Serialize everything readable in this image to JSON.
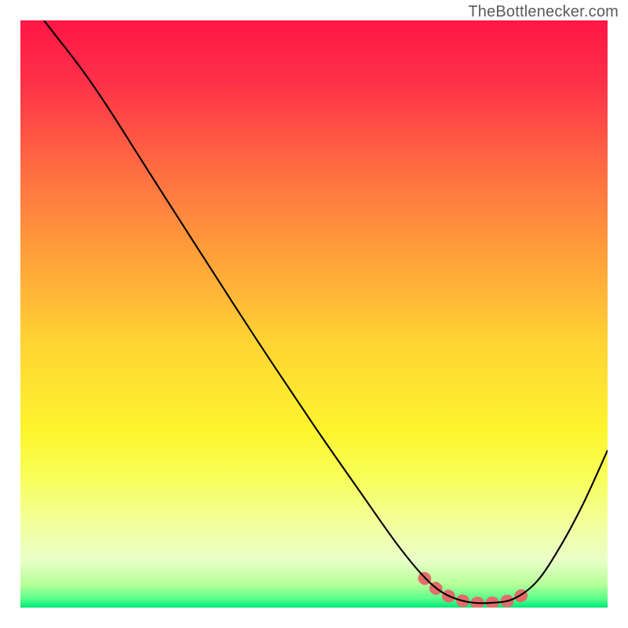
{
  "watermark": "TheBottlenecker.com",
  "chart_data": {
    "type": "line",
    "title": "",
    "xlabel": "",
    "ylabel": "",
    "xlim": [
      0,
      1
    ],
    "ylim": [
      0,
      1
    ],
    "gradient_stops": [
      {
        "offset": 0.0,
        "color": "#ff1744"
      },
      {
        "offset": 0.1,
        "color": "#ff2f49"
      },
      {
        "offset": 0.25,
        "color": "#ff6b42"
      },
      {
        "offset": 0.4,
        "color": "#ffa03a"
      },
      {
        "offset": 0.55,
        "color": "#ffd433"
      },
      {
        "offset": 0.7,
        "color": "#fdf52e"
      },
      {
        "offset": 0.78,
        "color": "#f8ff5a"
      },
      {
        "offset": 0.86,
        "color": "#f2ffa0"
      },
      {
        "offset": 0.92,
        "color": "#e8ffc8"
      },
      {
        "offset": 0.96,
        "color": "#b8ff9a"
      },
      {
        "offset": 0.985,
        "color": "#5aff8a"
      },
      {
        "offset": 1.0,
        "color": "#00e878"
      }
    ],
    "series": [
      {
        "name": "curve",
        "color": "#000000",
        "width": 2.1,
        "points": [
          {
            "x": 0.04,
            "y": 1.0
          },
          {
            "x": 0.065,
            "y": 0.968
          },
          {
            "x": 0.09,
            "y": 0.936
          },
          {
            "x": 0.12,
            "y": 0.895
          },
          {
            "x": 0.16,
            "y": 0.835
          },
          {
            "x": 0.22,
            "y": 0.74
          },
          {
            "x": 0.3,
            "y": 0.615
          },
          {
            "x": 0.4,
            "y": 0.46
          },
          {
            "x": 0.5,
            "y": 0.31
          },
          {
            "x": 0.58,
            "y": 0.195
          },
          {
            "x": 0.64,
            "y": 0.11
          },
          {
            "x": 0.685,
            "y": 0.055
          },
          {
            "x": 0.72,
            "y": 0.025
          },
          {
            "x": 0.76,
            "y": 0.01
          },
          {
            "x": 0.8,
            "y": 0.008
          },
          {
            "x": 0.84,
            "y": 0.015
          },
          {
            "x": 0.88,
            "y": 0.045
          },
          {
            "x": 0.92,
            "y": 0.105
          },
          {
            "x": 0.96,
            "y": 0.18
          },
          {
            "x": 1.0,
            "y": 0.268
          }
        ]
      },
      {
        "name": "highlight-band",
        "type": "segment",
        "color": "#e26d6a",
        "width": 16,
        "linecap": "round",
        "points": [
          {
            "x": 0.688,
            "y": 0.05
          },
          {
            "x": 0.72,
            "y": 0.024
          },
          {
            "x": 0.76,
            "y": 0.01
          },
          {
            "x": 0.8,
            "y": 0.008
          },
          {
            "x": 0.84,
            "y": 0.014
          },
          {
            "x": 0.87,
            "y": 0.032
          }
        ]
      }
    ]
  }
}
